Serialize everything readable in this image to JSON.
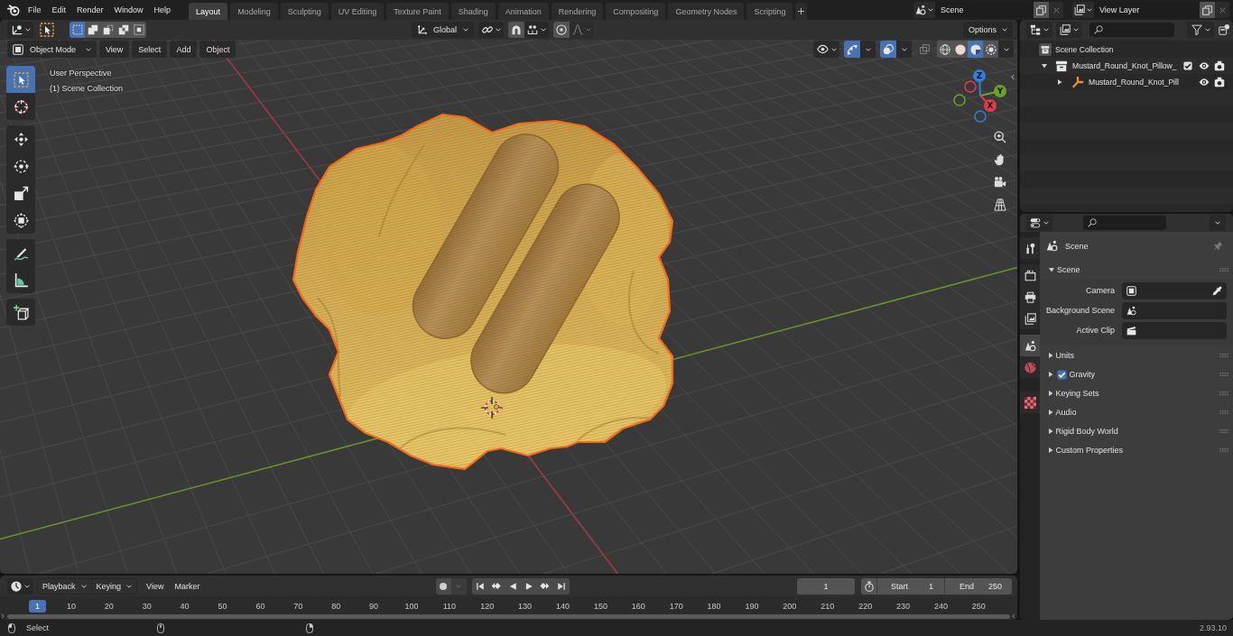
{
  "top_bar": {
    "menus": [
      "File",
      "Edit",
      "Render",
      "Window",
      "Help"
    ],
    "workspaces": [
      {
        "label": "Layout",
        "selected": true
      },
      {
        "label": "Modeling",
        "selected": false
      },
      {
        "label": "Sculpting",
        "selected": false
      },
      {
        "label": "UV Editing",
        "selected": false
      },
      {
        "label": "Texture Paint",
        "selected": false
      },
      {
        "label": "Shading",
        "selected": false
      },
      {
        "label": "Animation",
        "selected": false
      },
      {
        "label": "Rendering",
        "selected": false
      },
      {
        "label": "Compositing",
        "selected": false
      },
      {
        "label": "Geometry Nodes",
        "selected": false
      },
      {
        "label": "Scripting",
        "selected": false
      }
    ],
    "scene": {
      "value": "Scene"
    },
    "view_layer": {
      "value": "View Layer"
    }
  },
  "tool_header": {
    "selection_modes": [
      {
        "kind": "new",
        "selected": true
      },
      {
        "kind": "extend",
        "selected": false
      },
      {
        "kind": "subtract",
        "selected": false
      },
      {
        "kind": "difference",
        "selected": false
      },
      {
        "kind": "intersect",
        "selected": false
      }
    ],
    "orientation": "Global",
    "snapping": {
      "on": false
    },
    "proportional_editing": {
      "on": false
    },
    "options": "Options"
  },
  "viewport_header": {
    "mode": "Object Mode",
    "menus": [
      "View",
      "Select",
      "Add",
      "Object"
    ],
    "gizmos": {
      "on": true
    },
    "overlays": {
      "on": true
    },
    "xray": {
      "on": false
    },
    "shading": [
      {
        "kind": "wireframe",
        "selected": false
      },
      {
        "kind": "solid",
        "selected": false
      },
      {
        "kind": "material",
        "selected": true
      },
      {
        "kind": "rendered",
        "selected": false
      }
    ]
  },
  "toolbar": {
    "groups": [
      {
        "tools": [
          {
            "kind": "select-box",
            "selected": true
          },
          {
            "kind": "cursor",
            "selected": false
          }
        ]
      },
      {
        "tools": [
          {
            "kind": "move",
            "selected": false
          },
          {
            "kind": "rotate",
            "selected": false
          },
          {
            "kind": "scale",
            "selected": false
          },
          {
            "kind": "transform",
            "selected": false
          }
        ]
      },
      {
        "tools": [
          {
            "kind": "annotate",
            "selected": false
          },
          {
            "kind": "measure",
            "selected": false
          }
        ]
      },
      {
        "tools": [
          {
            "kind": "add-cube",
            "selected": false
          }
        ]
      }
    ]
  },
  "viewport": {
    "info": [
      "User Perspective",
      "(1) Scene Collection"
    ],
    "gizmo_axes": [
      {
        "kind": "z",
        "label": "Z",
        "color": "#2f7fe0"
      },
      {
        "kind": "y",
        "label": "Y",
        "color": "#6ca22a"
      },
      {
        "kind": "x",
        "label": "X",
        "color": "#e33a4e"
      }
    ]
  },
  "outliner": {
    "tree": [
      {
        "kind": "scene-collection",
        "label": "Scene Collection",
        "children": [
          {
            "kind": "collection",
            "label": "Mustard_Round_Knot_Pillow_",
            "expanded": true,
            "checked": true,
            "children": [
              {
                "kind": "object",
                "label": "Mustard_Round_Knot_Pill",
                "expanded": false
              }
            ]
          }
        ]
      }
    ]
  },
  "properties": {
    "tab_groups": [
      {
        "tabs": [
          {
            "kind": "tool",
            "selected": false
          }
        ]
      },
      {
        "tabs": [
          {
            "kind": "render",
            "selected": false
          },
          {
            "kind": "output",
            "selected": false
          },
          {
            "kind": "view-layer",
            "selected": false
          }
        ]
      },
      {
        "tabs": [
          {
            "kind": "scene",
            "selected": true
          },
          {
            "kind": "world",
            "selected": false
          }
        ]
      },
      {
        "tabs": [
          {
            "kind": "texture",
            "selected": false
          }
        ]
      }
    ],
    "context": "Scene",
    "panels": [
      {
        "kind": "panel",
        "title": "Scene",
        "expanded": true,
        "fields": [
          {
            "label": "Camera",
            "kind": "object"
          },
          {
            "label": "Background Scene",
            "kind": "scene"
          },
          {
            "label": "Active Clip",
            "kind": "clip"
          }
        ]
      },
      {
        "kind": "panel",
        "title": "Units",
        "expanded": false
      },
      {
        "kind": "toggle",
        "title": "Gravity",
        "expanded": false,
        "checked": true
      },
      {
        "kind": "panel",
        "title": "Keying Sets",
        "expanded": false
      },
      {
        "kind": "panel",
        "title": "Audio",
        "expanded": false
      },
      {
        "kind": "panel",
        "title": "Rigid Body World",
        "expanded": false
      },
      {
        "kind": "panel",
        "title": "Custom Properties",
        "expanded": false
      }
    ]
  },
  "timeline": {
    "menus": [
      {
        "label": "Playback",
        "kind": "dropdown"
      },
      {
        "label": "Keying",
        "kind": "dropdown"
      },
      {
        "label": "View",
        "kind": "menu"
      },
      {
        "label": "Marker",
        "kind": "menu"
      }
    ],
    "auto_keying": {
      "on": false
    },
    "current_frame": "1",
    "start": {
      "label": "Start",
      "value": "1"
    },
    "end": {
      "label": "End",
      "value": "250"
    },
    "playhead": "1",
    "ruler_labels": [
      "10",
      "20",
      "30",
      "40",
      "50",
      "60",
      "70",
      "80",
      "90",
      "100",
      "110",
      "120",
      "130",
      "140",
      "150",
      "160",
      "170",
      "180",
      "190",
      "200",
      "210",
      "220",
      "230",
      "240",
      "250"
    ]
  },
  "status_bar": {
    "mouse_hints": [
      {
        "kind": "left",
        "label": "Select"
      },
      {
        "kind": "middle"
      },
      {
        "kind": "right"
      }
    ],
    "version": "2.93.10"
  }
}
